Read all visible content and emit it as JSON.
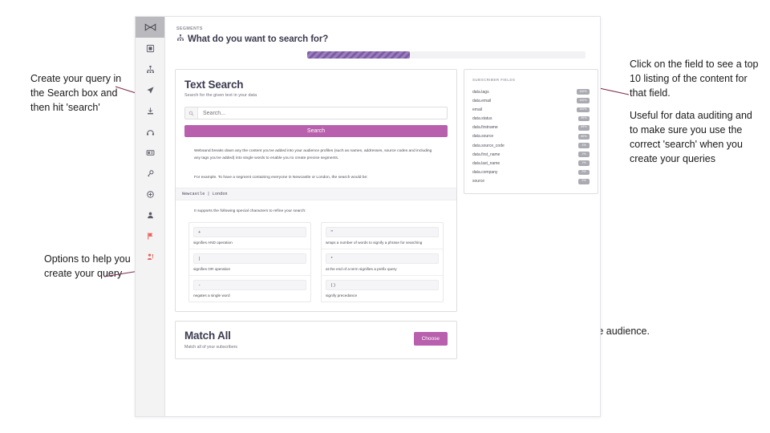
{
  "app": {
    "sidebar": {
      "items": [
        {
          "icon": "logo-bowtie-icon",
          "name": "sidebar-item-logo",
          "active": true
        },
        {
          "icon": "dashboard-icon",
          "name": "sidebar-item-dashboard",
          "active": false
        },
        {
          "icon": "segments-icon",
          "name": "sidebar-item-segments",
          "active": false
        },
        {
          "icon": "send-icon",
          "name": "sidebar-item-campaigns",
          "active": false
        },
        {
          "icon": "import-icon",
          "name": "sidebar-item-import",
          "active": false
        },
        {
          "icon": "automation-icon",
          "name": "sidebar-item-automation",
          "active": false
        },
        {
          "icon": "cards-icon",
          "name": "sidebar-item-templates",
          "active": false
        },
        {
          "icon": "key-icon",
          "name": "sidebar-item-api-keys",
          "active": false
        },
        {
          "icon": "settings-icon",
          "name": "sidebar-item-settings",
          "active": false
        },
        {
          "icon": "user-icon",
          "name": "sidebar-item-account",
          "active": false
        },
        {
          "icon": "flag-icon",
          "name": "sidebar-item-alerts",
          "active": false
        },
        {
          "icon": "person-alert-icon",
          "name": "sidebar-item-support",
          "active": false
        }
      ]
    },
    "header": {
      "eyebrow": "SEGMENTS",
      "title": "What do you want to search for?",
      "title_icon": "segment-tree-icon",
      "progress_percent": 37
    },
    "search_card": {
      "title": "Text Search",
      "subtitle": "Search for the given text in your data",
      "search_placeholder": "Search...",
      "search_icon": "magnifier-icon",
      "search_button": "Search",
      "paragraph_1": "Websand breaks down any the content you've added into your audience profiles (such as names, addresses, source codes and including any tags you've added) into single words to enable you to create precise segments.",
      "paragraph_2": "For example. To have a segment containing everyone in Newcastle or London, the search would be:",
      "code_example": "Newcastle | London",
      "paragraph_3": "It supports the following special characters to refine your search:",
      "special_chars_left": [
        {
          "symbol": "+",
          "desc": "signifies AND operation"
        },
        {
          "symbol": "|",
          "desc": "signifies OR operation"
        },
        {
          "symbol": "-",
          "desc": "negates a single word"
        }
      ],
      "special_chars_right": [
        {
          "symbol": "\"",
          "desc": "wraps a number of words to signify a phrase for searching"
        },
        {
          "symbol": "*",
          "desc": "at the end of a term signifies a prefix query"
        },
        {
          "symbol": "()",
          "desc": "signify precedance"
        }
      ]
    },
    "fields_card": {
      "heading": "SUBSCRIBER FIELDS",
      "rows": [
        {
          "name": "data.tags",
          "badge": "100%"
        },
        {
          "name": "data.email",
          "badge": "100%"
        },
        {
          "name": "email",
          "badge": "100%"
        },
        {
          "name": "data.status",
          "badge": "99%"
        },
        {
          "name": "data.firstname",
          "badge": "89%"
        },
        {
          "name": "data.source",
          "badge": "80%"
        },
        {
          "name": "data.source_code",
          "badge": "1%"
        },
        {
          "name": "data.first_name",
          "badge": "1%"
        },
        {
          "name": "data.last_name",
          "badge": "1%"
        },
        {
          "name": "data.company",
          "badge": "0%"
        },
        {
          "name": "source",
          "badge": "0%"
        }
      ]
    },
    "match_card": {
      "title": "Match All",
      "subtitle": "Match all of your subscribers",
      "choose_button": "Choose"
    }
  },
  "annotations": {
    "left_top": "Create your query in the Search box and then hit 'search'",
    "left_bottom": "Options to help you create your query",
    "right_top_1": "Click on the field to see a top 10 listing of the content for that field.",
    "right_top_2": "Useful for data auditing and to make sure you use the correct 'search' when you create your queries",
    "right_bottom": "Select your entire audience."
  },
  "colors": {
    "accent_purple": "#b85fad",
    "progress_purple": "#7d5ba6",
    "leader_line": "#7b2d4e",
    "alert_red": "#e8615a"
  }
}
